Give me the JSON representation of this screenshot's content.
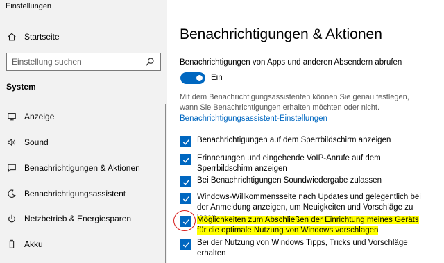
{
  "window": {
    "title": "Einstellungen"
  },
  "sidebar": {
    "home_label": "Startseite",
    "search_placeholder": "Einstellung suchen",
    "section": "System",
    "items": [
      {
        "label": "Anzeige",
        "icon": "monitor-icon"
      },
      {
        "label": "Sound",
        "icon": "speaker-icon"
      },
      {
        "label": "Benachrichtigungen & Aktionen",
        "icon": "message-icon"
      },
      {
        "label": "Benachrichtigungsassistent",
        "icon": "moon-icon"
      },
      {
        "label": "Netzbetrieb & Energiesparen",
        "icon": "power-icon"
      },
      {
        "label": "Akku",
        "icon": "battery-icon"
      }
    ]
  },
  "main": {
    "title": "Benachrichtigungen & Aktionen",
    "fetch_label": "Benachrichtigungen von Apps und anderen Absendern abrufen",
    "toggle_state": "Ein",
    "description": "Mit dem Benachrichtigungsassistenten können Sie genau festlegen, wann Sie Benachrichtigungen erhalten möchten oder nicht.",
    "link": "Benachrichtigungsassistent-Einstellungen",
    "checkboxes": [
      {
        "label": "Benachrichtigungen auf dem Sperrbildschirm anzeigen",
        "checked": true
      },
      {
        "label": "Erinnerungen und eingehende VoIP-Anrufe auf dem Sperrbildschirm anzeigen",
        "checked": true
      },
      {
        "label": "Bei Benachrichtigungen Soundwiedergabe zulassen",
        "checked": true
      },
      {
        "label": "Windows-Willkommensseite nach Updates und gelegentlich bei der Anmeldung anzeigen, um Neuigkeiten und Vorschläge zu lesen",
        "checked": true
      },
      {
        "label": "Möglichkeiten zum Abschließen der Einrichtung meines Geräts für die optimale Nutzung von Windows vorschlagen",
        "checked": true,
        "highlighted": true
      },
      {
        "label": "Bei der Nutzung von Windows Tipps, Tricks und Vorschläge erhalten",
        "checked": true
      }
    ]
  },
  "colors": {
    "accent": "#0067c0",
    "highlight": "#ffff00",
    "annotation": "#d81b1b",
    "sidebar_bg": "#f2f2f2"
  }
}
